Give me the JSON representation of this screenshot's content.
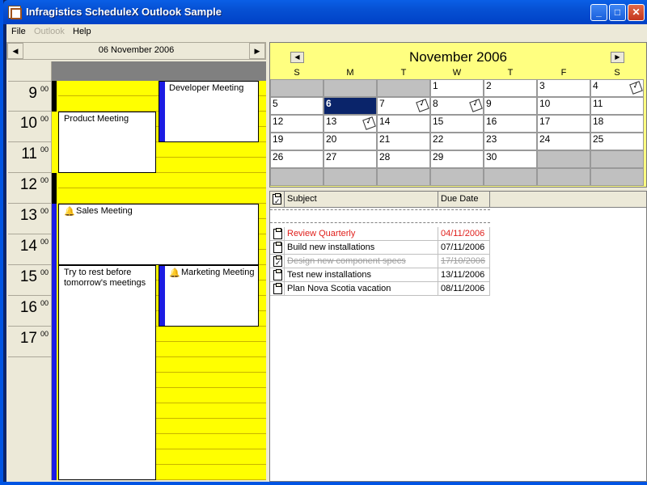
{
  "window": {
    "title": "Infragistics ScheduleX Outlook Sample"
  },
  "menu": [
    {
      "label": "File",
      "enabled": true
    },
    {
      "label": "Outlook",
      "enabled": false
    },
    {
      "label": "Help",
      "enabled": true
    }
  ],
  "day_view": {
    "date": "06 November 2006",
    "hours": [
      {
        "h": "9",
        "m": "00"
      },
      {
        "h": "10",
        "m": "00"
      },
      {
        "h": "11",
        "m": "00"
      },
      {
        "h": "12",
        "m": "00"
      },
      {
        "h": "13",
        "m": "00"
      },
      {
        "h": "14",
        "m": "00"
      },
      {
        "h": "15",
        "m": "00"
      },
      {
        "h": "16",
        "m": "00"
      },
      {
        "h": "17",
        "m": "00"
      }
    ],
    "appointments": [
      {
        "title": "Developer Meeting"
      },
      {
        "title": "Product Meeting"
      },
      {
        "title": "Sales Meeting"
      },
      {
        "title": "Try to rest before tomorrow's meetings"
      },
      {
        "title": "Marketing Meeting"
      }
    ]
  },
  "month_view": {
    "title": "November 2006",
    "days_of_week": [
      "S",
      "M",
      "T",
      "W",
      "T",
      "F",
      "S"
    ],
    "selected_day": "6",
    "weeks": [
      [
        "",
        "",
        "",
        "1",
        "2",
        "3",
        "4"
      ],
      [
        "5",
        "6",
        "7",
        "8",
        "9",
        "10",
        "11"
      ],
      [
        "12",
        "13",
        "14",
        "15",
        "16",
        "17",
        "18"
      ],
      [
        "19",
        "20",
        "21",
        "22",
        "23",
        "24",
        "25"
      ],
      [
        "26",
        "27",
        "28",
        "29",
        "30",
        "",
        ""
      ],
      [
        "",
        "",
        "",
        "",
        "",
        "",
        ""
      ]
    ],
    "days_with_notes": [
      "4",
      "7",
      "8",
      "13"
    ]
  },
  "tasks": {
    "columns": {
      "subject": "Subject",
      "due_date": "Due Date"
    },
    "rows": [
      {
        "subject": "Review Quarterly",
        "due": "04/11/2006",
        "status": "overdue"
      },
      {
        "subject": "Build new installations",
        "due": "07/11/2006",
        "status": "normal"
      },
      {
        "subject": "Design new component specs",
        "due": "17/10/2006",
        "status": "completed"
      },
      {
        "subject": "Test new installations",
        "due": "13/11/2006",
        "status": "normal"
      },
      {
        "subject": "Plan Nova Scotia vacation",
        "due": "08/11/2006",
        "status": "normal"
      }
    ]
  },
  "colors": {
    "day_background": "#FFFF00",
    "month_background": "#FFFF80",
    "selected": "#0A246A",
    "overdue": "#E0201C",
    "appointment_bar": "#1C1CE3"
  }
}
